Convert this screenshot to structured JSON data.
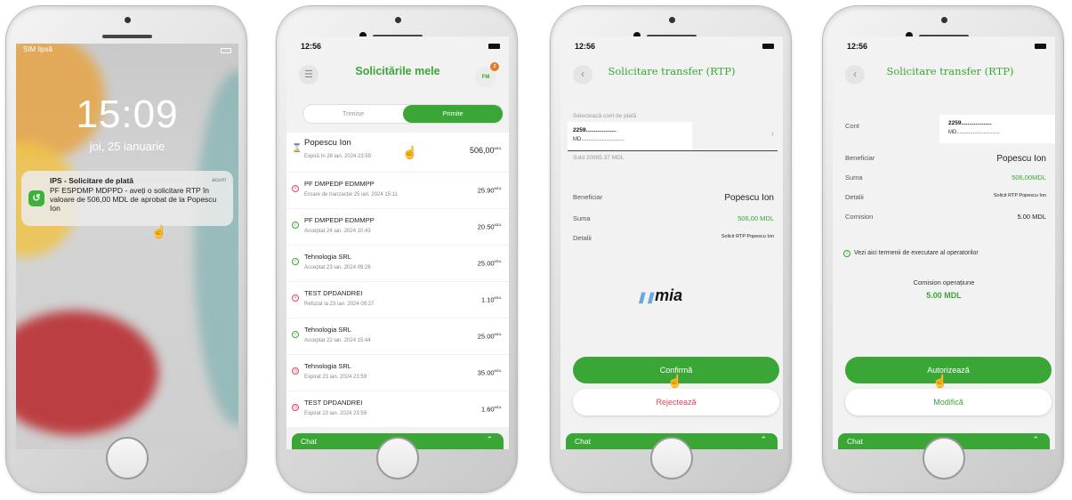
{
  "screen1": {
    "status_carrier": "SIM lipsă",
    "time": "15:09",
    "date": "joi, 25 ianuarie",
    "notification": {
      "title": "IPS - Solicitare de plată",
      "when": "acum",
      "body": "PF ESPDMP MDPPD - aveți o solicitare RTP în valoare de 506,00 MDL de aprobat de la Popescu Ion"
    }
  },
  "screen2": {
    "clock": "12:56",
    "title": "Solicitările mele",
    "avatar_initials": "FM",
    "avatar_badge": "2",
    "tabs": [
      "Trimise",
      "Primite"
    ],
    "rows": [
      {
        "name": "Popescu Ion",
        "sub": "Expiră în 26 ian. 2024 23:59",
        "amount": "506,00",
        "currency": "MDL",
        "status": "pending"
      },
      {
        "name": "PF DMPEDP EDMMPP",
        "sub": "Eroare de tranzacție 25 ian. 2024 15:11",
        "amount": "25.90",
        "currency": "MDL",
        "status": "error"
      },
      {
        "name": "PF DMPEDP EDMMPP",
        "sub": "Acceptat 24 ian. 2024 10:43",
        "amount": "20.50",
        "currency": "MDL",
        "status": "ok"
      },
      {
        "name": "Tehnologia SRL",
        "sub": "Acceptat 23 ian. 2024 09:26",
        "amount": "25.00",
        "currency": "MDL",
        "status": "ok"
      },
      {
        "name": "TEST DPDANDREI",
        "sub": "Refuzat la 23 ian. 2024 09:27",
        "amount": "1.10",
        "currency": "MDL",
        "status": "error"
      },
      {
        "name": "Tehnologia SRL",
        "sub": "Acceptat 22 ian. 2024 15:44",
        "amount": "25.00",
        "currency": "MDL",
        "status": "ok"
      },
      {
        "name": "Tehnologia SRL",
        "sub": "Expirat 23 ian. 2024 23:59",
        "amount": "35.00",
        "currency": "MDL",
        "status": "expired"
      },
      {
        "name": "TEST DPDANDREI",
        "sub": "Expirat 23 ian. 2024 23:59",
        "amount": "1.60",
        "currency": "MDL",
        "status": "expired"
      }
    ],
    "chat": "Chat"
  },
  "screen3": {
    "clock": "12:56",
    "title": "Solicitare transfer (RTP)",
    "account_label": "Selectează cont de plată",
    "account_number": "2259...................",
    "account_sub": "MD.............................",
    "balance": "Sold 20985.37 MDL",
    "beneficiar_label": "Beneficiar",
    "beneficiar_value": "Popescu Ion",
    "suma_label": "Suma",
    "suma_value": "506,00 MDL",
    "detalii_label": "Detalii",
    "detalii_value": "Solicit RTP Popescu Ion",
    "logo_text": "mia",
    "confirm_label": "Confirmă",
    "reject_label": "Rejectează",
    "chat": "Chat"
  },
  "screen4": {
    "clock": "12:56",
    "title": "Solicitare transfer (RTP)",
    "cont_label": "Cont",
    "cont_number": "2259...................",
    "cont_sub": "MD.............................",
    "beneficiar_label": "Beneficiar",
    "beneficiar_value": "Popescu Ion",
    "suma_label": "Suma",
    "suma_value": "506,00MDL",
    "detalii_label": "Detalii",
    "detalii_value": "Solicit RTP Popescu Ion",
    "comision_label": "Comision",
    "comision_value": "5.00 MDL",
    "terms_text": "Vezi aici termenii de executare al operatorilor",
    "op_fee_label": "Comision operațiune",
    "op_fee_value": "5.00 MDL",
    "authorize_label": "Autorizează",
    "modify_label": "Modifică",
    "chat": "Chat"
  },
  "colors": {
    "accent": "#3aa635",
    "error": "#e2445a",
    "expired": "#e2445a",
    "ok": "#3aa635",
    "pending": "#e07a2c"
  }
}
